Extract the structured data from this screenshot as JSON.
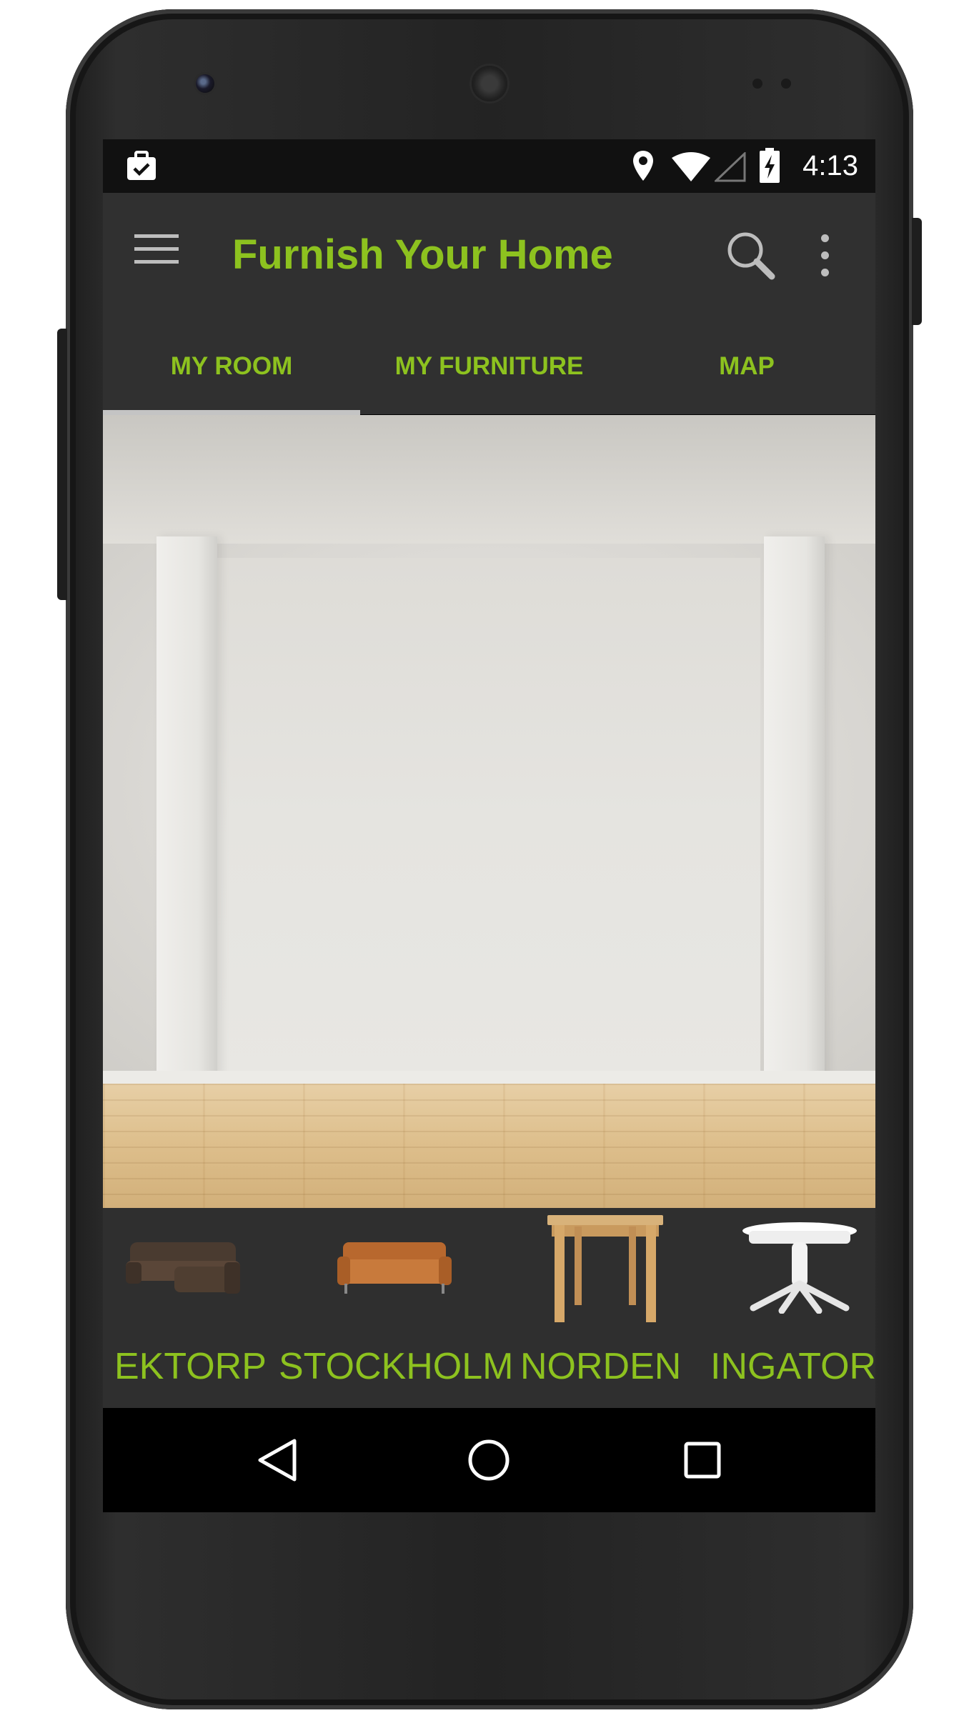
{
  "status_bar": {
    "time": "4:13",
    "icons": [
      "briefcase-check-icon",
      "location-pin-icon",
      "wifi-icon",
      "cell-signal-icon",
      "battery-charging-icon"
    ]
  },
  "app_bar": {
    "menu_icon": "hamburger-menu-icon",
    "title": "Furnish Your Home",
    "search_icon": "search-icon",
    "overflow_icon": "overflow-menu-icon"
  },
  "tabs": [
    {
      "label": "MY ROOM",
      "selected": true
    },
    {
      "label": "MY FURNITURE",
      "selected": false
    },
    {
      "label": "MAP",
      "selected": false
    }
  ],
  "furniture": [
    {
      "name": "EKTORP",
      "icon": "sectional-sofa-icon"
    },
    {
      "name": "STOCKHOLM",
      "icon": "leather-sofa-icon"
    },
    {
      "name": "NORDEN",
      "icon": "wooden-table-icon"
    },
    {
      "name": "INGATORP",
      "icon": "round-table-icon"
    }
  ],
  "nav_bar": {
    "back_icon": "back-icon",
    "home_icon": "home-icon",
    "recents_icon": "recents-icon"
  },
  "colors": {
    "accent": "#8dc21f",
    "toolbar": "#303030",
    "status_bar": "#111111"
  }
}
